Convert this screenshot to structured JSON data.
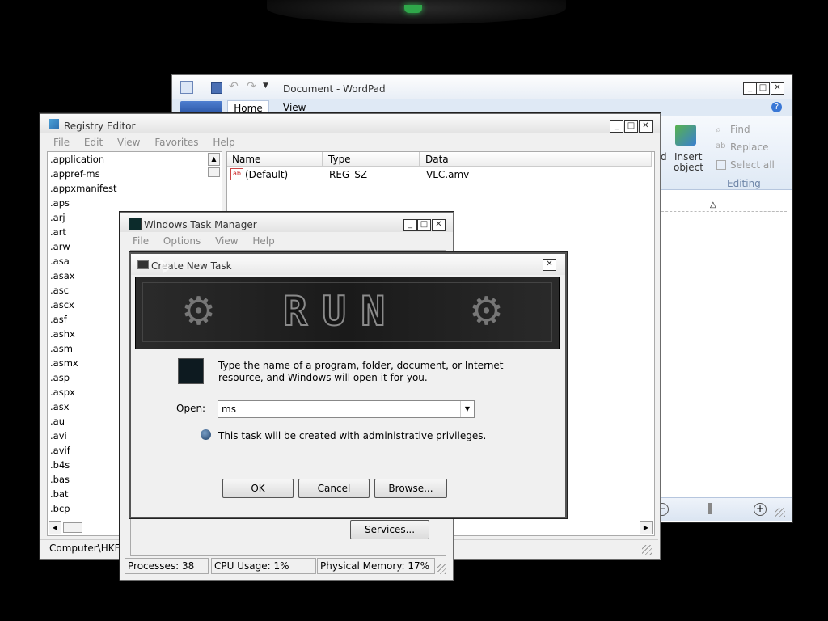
{
  "wordpad": {
    "title": "Document - WordPad",
    "tabs": [
      "Home",
      "View"
    ],
    "ribbon": {
      "insert_object": "Insert\nobject",
      "insert_object_l1": "Insert",
      "insert_object_l2": "object",
      "find": "Find",
      "replace": "Replace",
      "select_all": "Select all",
      "editing": "Editing",
      "cut_fragment": "d"
    }
  },
  "registry": {
    "title": "Registry Editor",
    "menu": [
      "File",
      "Edit",
      "View",
      "Favorites",
      "Help"
    ],
    "tree": [
      ".application",
      ".appref-ms",
      ".appxmanifest",
      ".aps",
      ".arj",
      ".art",
      ".arw",
      ".asa",
      ".asax",
      ".asc",
      ".ascx",
      ".asf",
      ".ashx",
      ".asm",
      ".asmx",
      ".asp",
      ".aspx",
      ".asx",
      ".au",
      ".avi",
      ".avif",
      ".b4s",
      ".bas",
      ".bat",
      ".bcp"
    ],
    "columns": [
      "Name",
      "Type",
      "Data"
    ],
    "row": {
      "name": "(Default)",
      "type": "REG_SZ",
      "data": "VLC.amv"
    },
    "status": "Computer\\HKEY"
  },
  "taskmgr": {
    "title": "Windows Task Manager",
    "menu": [
      "File",
      "Options",
      "View",
      "Help"
    ],
    "services_button": "Services...",
    "status": {
      "processes": "Processes: 38",
      "cpu": "CPU Usage: 1%",
      "memory": "Physical Memory: 17%"
    }
  },
  "run": {
    "title": "Create New Task",
    "banner_text": "RUN",
    "description": "Type the name of a program, folder, document, or Internet resource, and Windows will open it for you.",
    "desc_line1": "Type the name of a program, folder, document, or Internet",
    "desc_line2": "resource, and Windows will open it for you.",
    "open_label": "Open:",
    "open_value": "ms",
    "admin_note": "This task will be created with administrative privileges.",
    "ok": "OK",
    "cancel": "Cancel",
    "browse": "Browse..."
  },
  "colors": {
    "desktop": "#000000",
    "window_bg": "#f0f0f0",
    "wordpad_ribbon": "#dfe9f5",
    "run_banner": "#1a1a1a"
  },
  "window_buttons": {
    "minimize": "_",
    "maximize": "□",
    "close": "✕"
  }
}
